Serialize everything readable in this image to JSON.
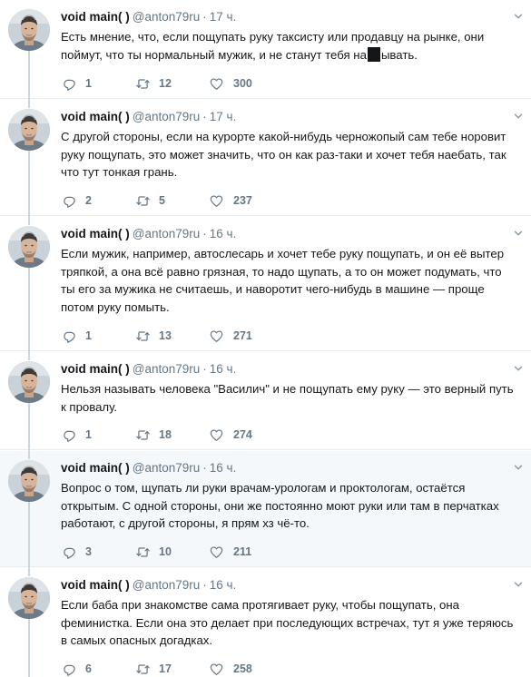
{
  "tweets": [
    {
      "name": "void main( )",
      "handle": "@anton79ru",
      "dot": "·",
      "time": "17 ч.",
      "text_a": "Есть мнение, что, если пощупать руку таксисту или продавцу на рынке, они поймут, что ты нормальный мужик, и не станут тебя на",
      "text_b": "ывать.",
      "replies": "1",
      "retweets": "12",
      "likes": "300"
    },
    {
      "name": "void main( )",
      "handle": "@anton79ru",
      "dot": "·",
      "time": "17 ч.",
      "text": "С другой стороны, если на курорте какой-нибудь черножопый сам тебе норовит руку пощупать, это может значить, что он как раз-таки и хочет тебя наебать, так что тут тонкая грань.",
      "replies": "2",
      "retweets": "5",
      "likes": "237"
    },
    {
      "name": "void main( )",
      "handle": "@anton79ru",
      "dot": "·",
      "time": "16 ч.",
      "text": "Если мужик, например, автослесарь и хочет тебе руку пощупать, и он её вытер тряпкой, а она всё равно грязная, то надо щупать, а то он может подумать, что ты его за мужика не считаешь, и наворотит чего-нибудь в машине — проще потом руку помыть.",
      "replies": "1",
      "retweets": "13",
      "likes": "271"
    },
    {
      "name": "void main( )",
      "handle": "@anton79ru",
      "dot": "·",
      "time": "16 ч.",
      "text": "Нельзя называть человека \"Василич\" и не пощупать ему руку — это верный путь к провалу.",
      "replies": "1",
      "retweets": "18",
      "likes": "274"
    },
    {
      "name": "void main( )",
      "handle": "@anton79ru",
      "dot": "·",
      "time": "16 ч.",
      "text": "Вопрос о том, щупать ли руки врачам-урологам и проктологам, остаётся открытым. С одной стороны, они же постоянно моют руки или там в перчатках работают, с другой стороны, я прям хз чё-то.",
      "replies": "3",
      "retweets": "10",
      "likes": "211"
    },
    {
      "name": "void main( )",
      "handle": "@anton79ru",
      "dot": "·",
      "time": "16 ч.",
      "text": "Если баба при знакомстве сама протягивает руку, чтобы пощупать, она феминистка. Если она это делает при последующих встречах, тут я уже теряюсь в самых опасных догадках.",
      "replies": "6",
      "retweets": "17",
      "likes": "258"
    }
  ],
  "colors": {
    "text": "#14171a",
    "muted": "#657786",
    "divider": "#e6ecf0",
    "thread_line": "#ccd6dd",
    "highlight_bg": "#f5f8fa"
  },
  "icons": [
    "reply-icon",
    "retweet-icon",
    "like-icon",
    "caret-down-icon"
  ]
}
